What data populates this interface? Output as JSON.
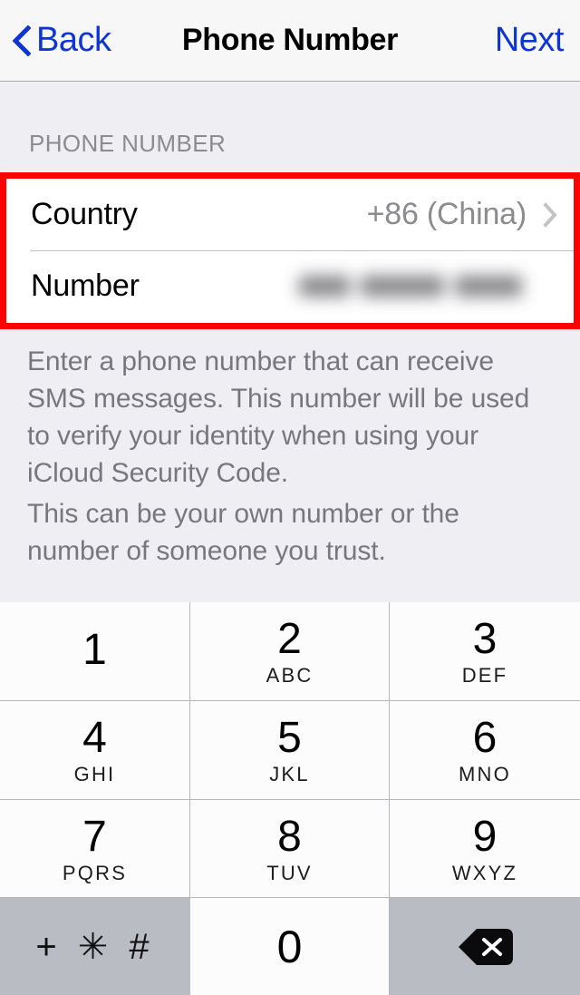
{
  "navbar": {
    "back_label": "Back",
    "back_icon": "chevron-left-icon",
    "title": "Phone Number",
    "next_label": "Next"
  },
  "section": {
    "header": "PHONE NUMBER"
  },
  "form": {
    "rows": [
      {
        "label": "Country",
        "value": "+86 (China)",
        "accessory": "chevron-right-icon",
        "redacted": false
      },
      {
        "label": "Number",
        "value": "",
        "accessory": "",
        "redacted": true
      }
    ]
  },
  "footnotes": [
    "Enter a phone number that can receive SMS messages. This number will be used to verify your identity when using your iCloud Security Code.",
    "This can be your own number or the number of someone you trust."
  ],
  "keypad": {
    "keys": [
      {
        "digit": "1",
        "letters": ""
      },
      {
        "digit": "2",
        "letters": "ABC"
      },
      {
        "digit": "3",
        "letters": "DEF"
      },
      {
        "digit": "4",
        "letters": "GHI"
      },
      {
        "digit": "5",
        "letters": "JKL"
      },
      {
        "digit": "6",
        "letters": "MNO"
      },
      {
        "digit": "7",
        "letters": "PQRS"
      },
      {
        "digit": "8",
        "letters": "TUV"
      },
      {
        "digit": "9",
        "letters": "WXYZ"
      }
    ],
    "symbols_key": "+ ✳ #",
    "zero_key": "0",
    "delete_icon": "backspace-icon"
  },
  "colors": {
    "accent_blue": "#0d35d6",
    "highlight_red": "#fe0000",
    "background": "#efeef3",
    "navbar": "#f7f7f7",
    "key_gray": "#b9bcc2",
    "secondary_text": "#8b8b90"
  }
}
